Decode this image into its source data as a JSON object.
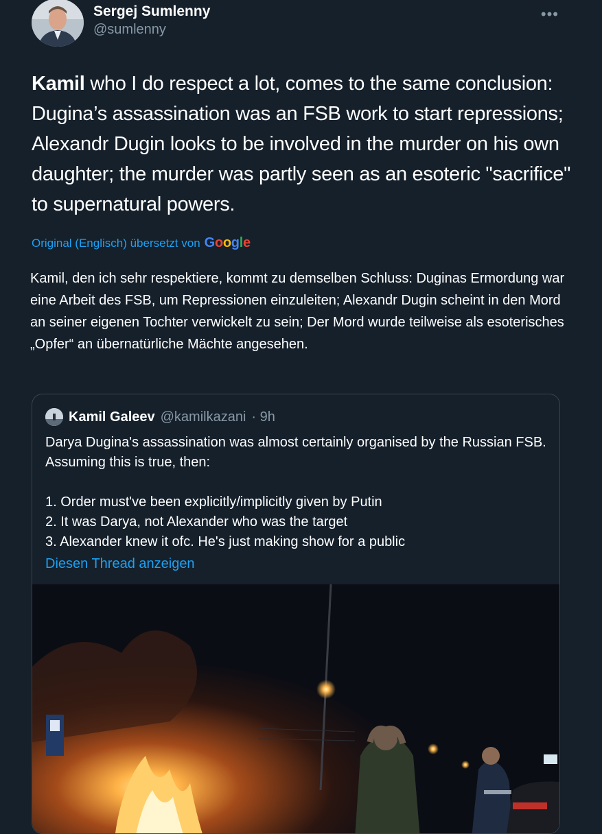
{
  "author": {
    "display_name": "Sergej Sumlenny",
    "handle": "@sumlenny"
  },
  "more_icon": "more-horizontal-icon",
  "tweet": {
    "bold_name": "Kamil",
    "text_rest": " who I do respect a lot, comes to the same conclusion: Dugina’s assassination was an FSB work to start repressions; Alexandr Dugin looks to be involved in the murder on his own daughter; the murder was partly seen as an esoteric \"sacrifice\" to supernatural powers."
  },
  "translation": {
    "attribution": "Original (Englisch) übersetzt von",
    "provider": "Google",
    "text": "Kamil, den ich sehr respektiere, kommt zu demselben Schluss: Duginas Ermordung war eine Arbeit des FSB, um Repressionen einzuleiten; Alexandr Dugin scheint in den Mord an seiner eigenen Tochter verwickelt zu sein; Der Mord wurde teilweise als esoterisches „Opfer“ an übernatürliche Mächte angesehen."
  },
  "quoted_tweet": {
    "display_name": "Kamil Galeev",
    "handle": "@kamilkazani",
    "time": "· 9h",
    "intro": "Darya Dugina's assassination was almost certainly organised by the Russian FSB. Assuming this is true, then:",
    "points": [
      "1. Order must've been explicitly/implicitly given by Putin",
      "2. It was Darya, not Alexander who was the target",
      "3. Alexander knew it ofc. He's just making show for a public"
    ],
    "show_thread": "Diesen Thread anzeigen"
  },
  "colors": {
    "background": "#15202b",
    "link": "#1da1f2",
    "secondary_text": "#8899a6",
    "border": "#38444d"
  }
}
